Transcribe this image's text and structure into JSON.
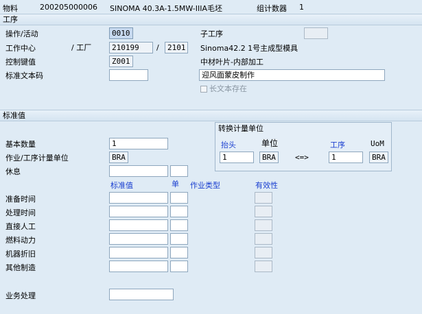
{
  "header": {
    "material_label": "物料",
    "material_number": "200205000006",
    "material_desc": "SINOMA 40.3A-1.5MW-IIIA毛坯",
    "group_counter_label": "组计数器",
    "group_counter_value": "1"
  },
  "operation_section": {
    "title": "工序",
    "activity_label": "操作/活动",
    "activity_value": "0010",
    "sub_operation_label": "子工序",
    "sub_operation_value": "",
    "work_center_label": "工作中心",
    "plant_label": "/ 工厂",
    "work_center_value": "210199",
    "slash": "/",
    "plant_value": "2101",
    "work_center_desc": "Sinoma42.2 1号主成型模具",
    "control_key_label": "控制键值",
    "control_key_value": "Z001",
    "control_key_desc": "中材叶片-内部加工",
    "std_text_label": "标准文本码",
    "std_text_value": "",
    "operation_text": "迎风面蒙皮制作",
    "long_text_label": "长文本存在"
  },
  "standard_values_section": {
    "title": "标准值",
    "base_qty_label": "基本数量",
    "base_qty_value": "1",
    "uom_label": "作业/工序计量单位",
    "uom_value": "BRA",
    "break_label": "休息",
    "col_std_value": "标准值",
    "col_unit": "单",
    "col_activity_type": "作业类型",
    "col_effectivity": "有效性",
    "rows": [
      {
        "label": "准备时间"
      },
      {
        "label": "处理时间"
      },
      {
        "label": "直接人工"
      },
      {
        "label": "燃料动力"
      },
      {
        "label": "机器折旧"
      },
      {
        "label": "其他制造"
      }
    ],
    "business_process_label": "业务处理"
  },
  "conversion_box": {
    "title": "转换计量单位",
    "header_label": "抬头",
    "unit_label": "单位",
    "operation_label": "工序",
    "uom_label": "UoM",
    "header_qty": "1",
    "header_unit": "BRA",
    "arrow": "<=>",
    "operation_qty": "1",
    "operation_unit": "BRA"
  },
  "colors": {
    "background": "#dfebf5",
    "label_blue": "#1a3fd0",
    "field_border": "#8da6bd"
  }
}
